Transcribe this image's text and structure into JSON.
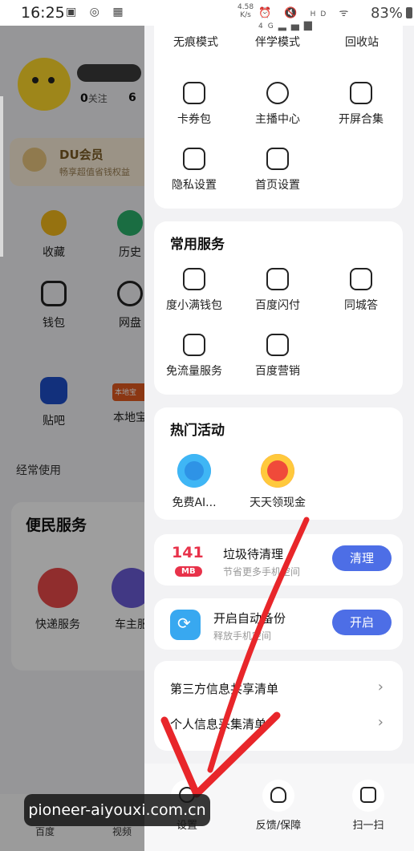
{
  "status": {
    "time": "16:25",
    "net_speed_value": "4.58",
    "net_speed_unit": "K/s",
    "hd": "HD",
    "net_type": "4G",
    "battery": "83%"
  },
  "left_page": {
    "follow_count": "0",
    "follow_label": "关注",
    "partial_count": "6",
    "du": {
      "title": "DU会员",
      "subtitle": "畅享超值省钱权益"
    },
    "grid1": [
      "收藏",
      "历史",
      "钱包",
      "网盘"
    ],
    "grid2": [
      "贴吧",
      "本地宝"
    ],
    "shop_logo_text": "本地宝",
    "frequent_label": "经常使用",
    "service_title": "便民服务",
    "services": [
      "快递服务",
      "车主服"
    ],
    "bottom_tabs": [
      "百度",
      "视频"
    ]
  },
  "drawer": {
    "top_row": [
      "无痕模式",
      "伴学模式",
      "回收站"
    ],
    "grid_a": [
      "卡券包",
      "主播中心",
      "开屏合集",
      "隐私设置",
      "首页设置"
    ],
    "common_services": {
      "title": "常用服务",
      "items": [
        "度小满钱包",
        "百度闪付",
        "同城答",
        "免流量服务",
        "百度营销"
      ]
    },
    "hot": {
      "title": "热门活动",
      "items": [
        "免费AI...",
        "天天领现金"
      ]
    },
    "clean": {
      "number": "141",
      "unit": "MB",
      "title": "垃圾待清理",
      "subtitle": "节省更多手机空间",
      "button": "清理"
    },
    "backup": {
      "title": "开启自动备份",
      "subtitle": "释放手机空间",
      "button": "开启"
    },
    "list": [
      "第三方信息共享清单",
      "个人信息采集清单"
    ],
    "bottom": [
      "设置",
      "反馈/保障",
      "扫一扫"
    ]
  },
  "watermark": "pioneer-aiyouxi.com.cn",
  "colors": {
    "accent_button": "#4d6ee6",
    "clean_red": "#e8324a",
    "arrow_red": "#e8262a"
  }
}
